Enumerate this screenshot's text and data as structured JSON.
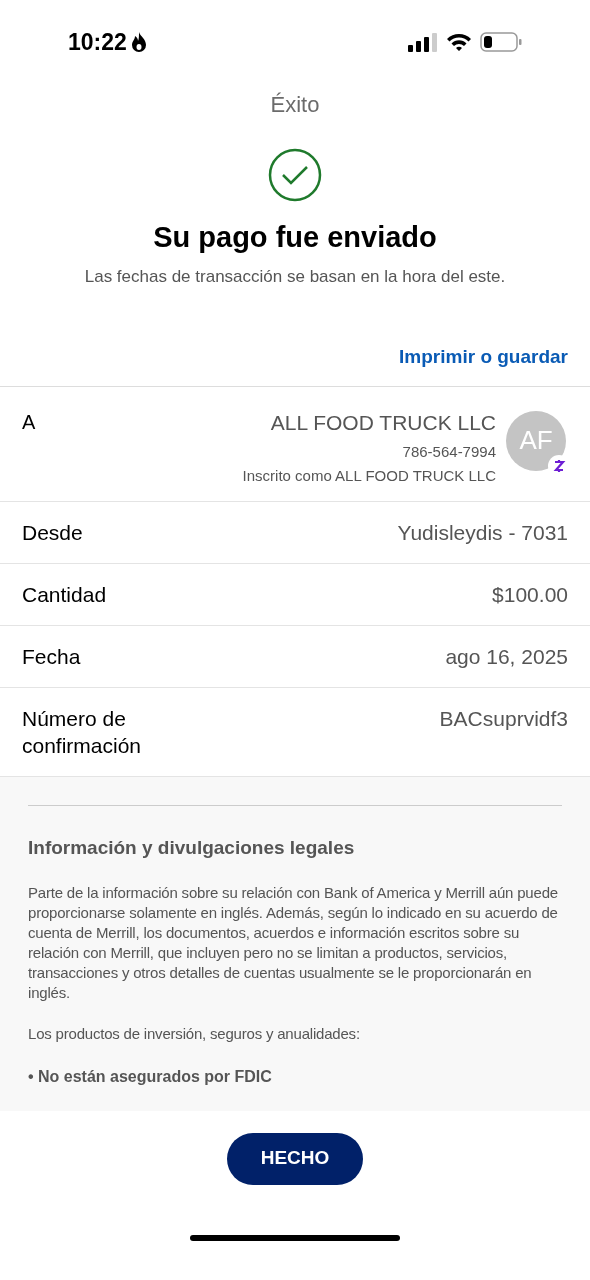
{
  "status_bar": {
    "time": "10:22"
  },
  "header": {
    "title": "Éxito"
  },
  "success": {
    "heading": "Su pago fue enviado",
    "subtitle": "Las fechas de transacción se basan en la hora del este."
  },
  "print_link": "Imprimir o guardar",
  "recipient": {
    "label": "A",
    "name": "ALL FOOD TRUCK LLC",
    "phone": "786-564-7994",
    "enrolled": "Inscrito como ALL FOOD TRUCK LLC",
    "initials": "AF"
  },
  "details": [
    {
      "label": "Desde",
      "value": "Yudisleydis - 7031"
    },
    {
      "label": "Cantidad",
      "value": "$100.00"
    },
    {
      "label": "Fecha",
      "value": "ago 16, 2025"
    },
    {
      "label": "Número de confirmación",
      "value": "BACsuprvidf3"
    }
  ],
  "legal": {
    "title": "Información y divulgaciones legales",
    "paragraphs": [
      "Parte de la información sobre su relación con Bank of America y Merrill aún puede proporcionarse solamente en inglés. Además, según lo indicado en su acuerdo de cuenta de Merrill, los documentos, acuerdos e información escritos sobre su relación con Merrill, que incluyen pero no se limitan a productos, servicios, transacciones y otros detalles de cuentas usualmente se le proporcionarán en inglés.",
      "Los productos de inversión, seguros y anualidades:"
    ],
    "bullet": "• No están asegurados por FDIC"
  },
  "done_button": "HECHO"
}
